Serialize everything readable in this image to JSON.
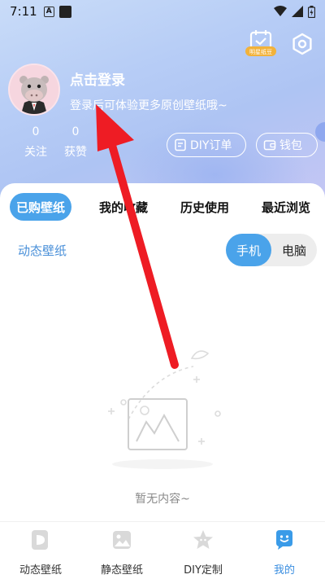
{
  "status_bar": {
    "time": "7:11",
    "app_icon_letter": "A"
  },
  "header": {
    "vip_badge_label": "明星纸豆",
    "login_title": "点击登录",
    "login_subtitle": "登录后可体验更多原创壁纸哦~",
    "stats": [
      {
        "value": "0",
        "label": "关注"
      },
      {
        "value": "0",
        "label": "获赞"
      }
    ],
    "buttons": {
      "diy_orders": "DIY订单",
      "wallet": "钱包"
    }
  },
  "tabs": [
    {
      "label": "已购壁纸",
      "active": true
    },
    {
      "label": "我的收藏",
      "active": false
    },
    {
      "label": "历史使用",
      "active": false
    },
    {
      "label": "最近浏览",
      "active": false
    }
  ],
  "filter": {
    "label": "动态壁纸"
  },
  "device_toggle": {
    "options": [
      "手机",
      "电脑"
    ],
    "selected": "手机"
  },
  "empty_state": {
    "text": "暂无内容~"
  },
  "bottom_nav": [
    {
      "label": "动态壁纸",
      "icon": "dynamic-wallpaper-icon",
      "active": false
    },
    {
      "label": "静态壁纸",
      "icon": "image-icon",
      "active": false
    },
    {
      "label": "DIY定制",
      "icon": "star-diy-icon",
      "active": false
    },
    {
      "label": "我的",
      "icon": "smile-profile-icon",
      "active": true
    }
  ],
  "colors": {
    "accent": "#4aa3ea",
    "link_blue": "#4a90d9",
    "annotation_arrow": "#ee1c24"
  }
}
